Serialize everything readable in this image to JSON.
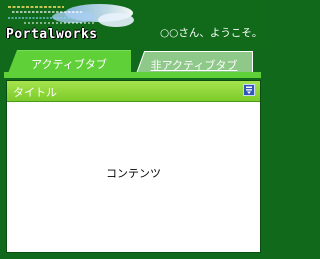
{
  "header": {
    "logo_text": "Portalworks",
    "welcome": "○○さん、ようこそ。"
  },
  "tabs": [
    {
      "label": "アクティブタブ",
      "state": "active"
    },
    {
      "label": "非アクティブタブ",
      "state": "inactive"
    }
  ],
  "portlet": {
    "title": "タイトル",
    "menu_icon": "portlet-menu-icon",
    "content": "コンテンツ"
  },
  "colors": {
    "background": "#116a1c",
    "tab_active": "#5fd038",
    "tab_inactive": "#8ec98a",
    "titlebar": "#8fd83a",
    "menu_button": "#2f56b8"
  }
}
